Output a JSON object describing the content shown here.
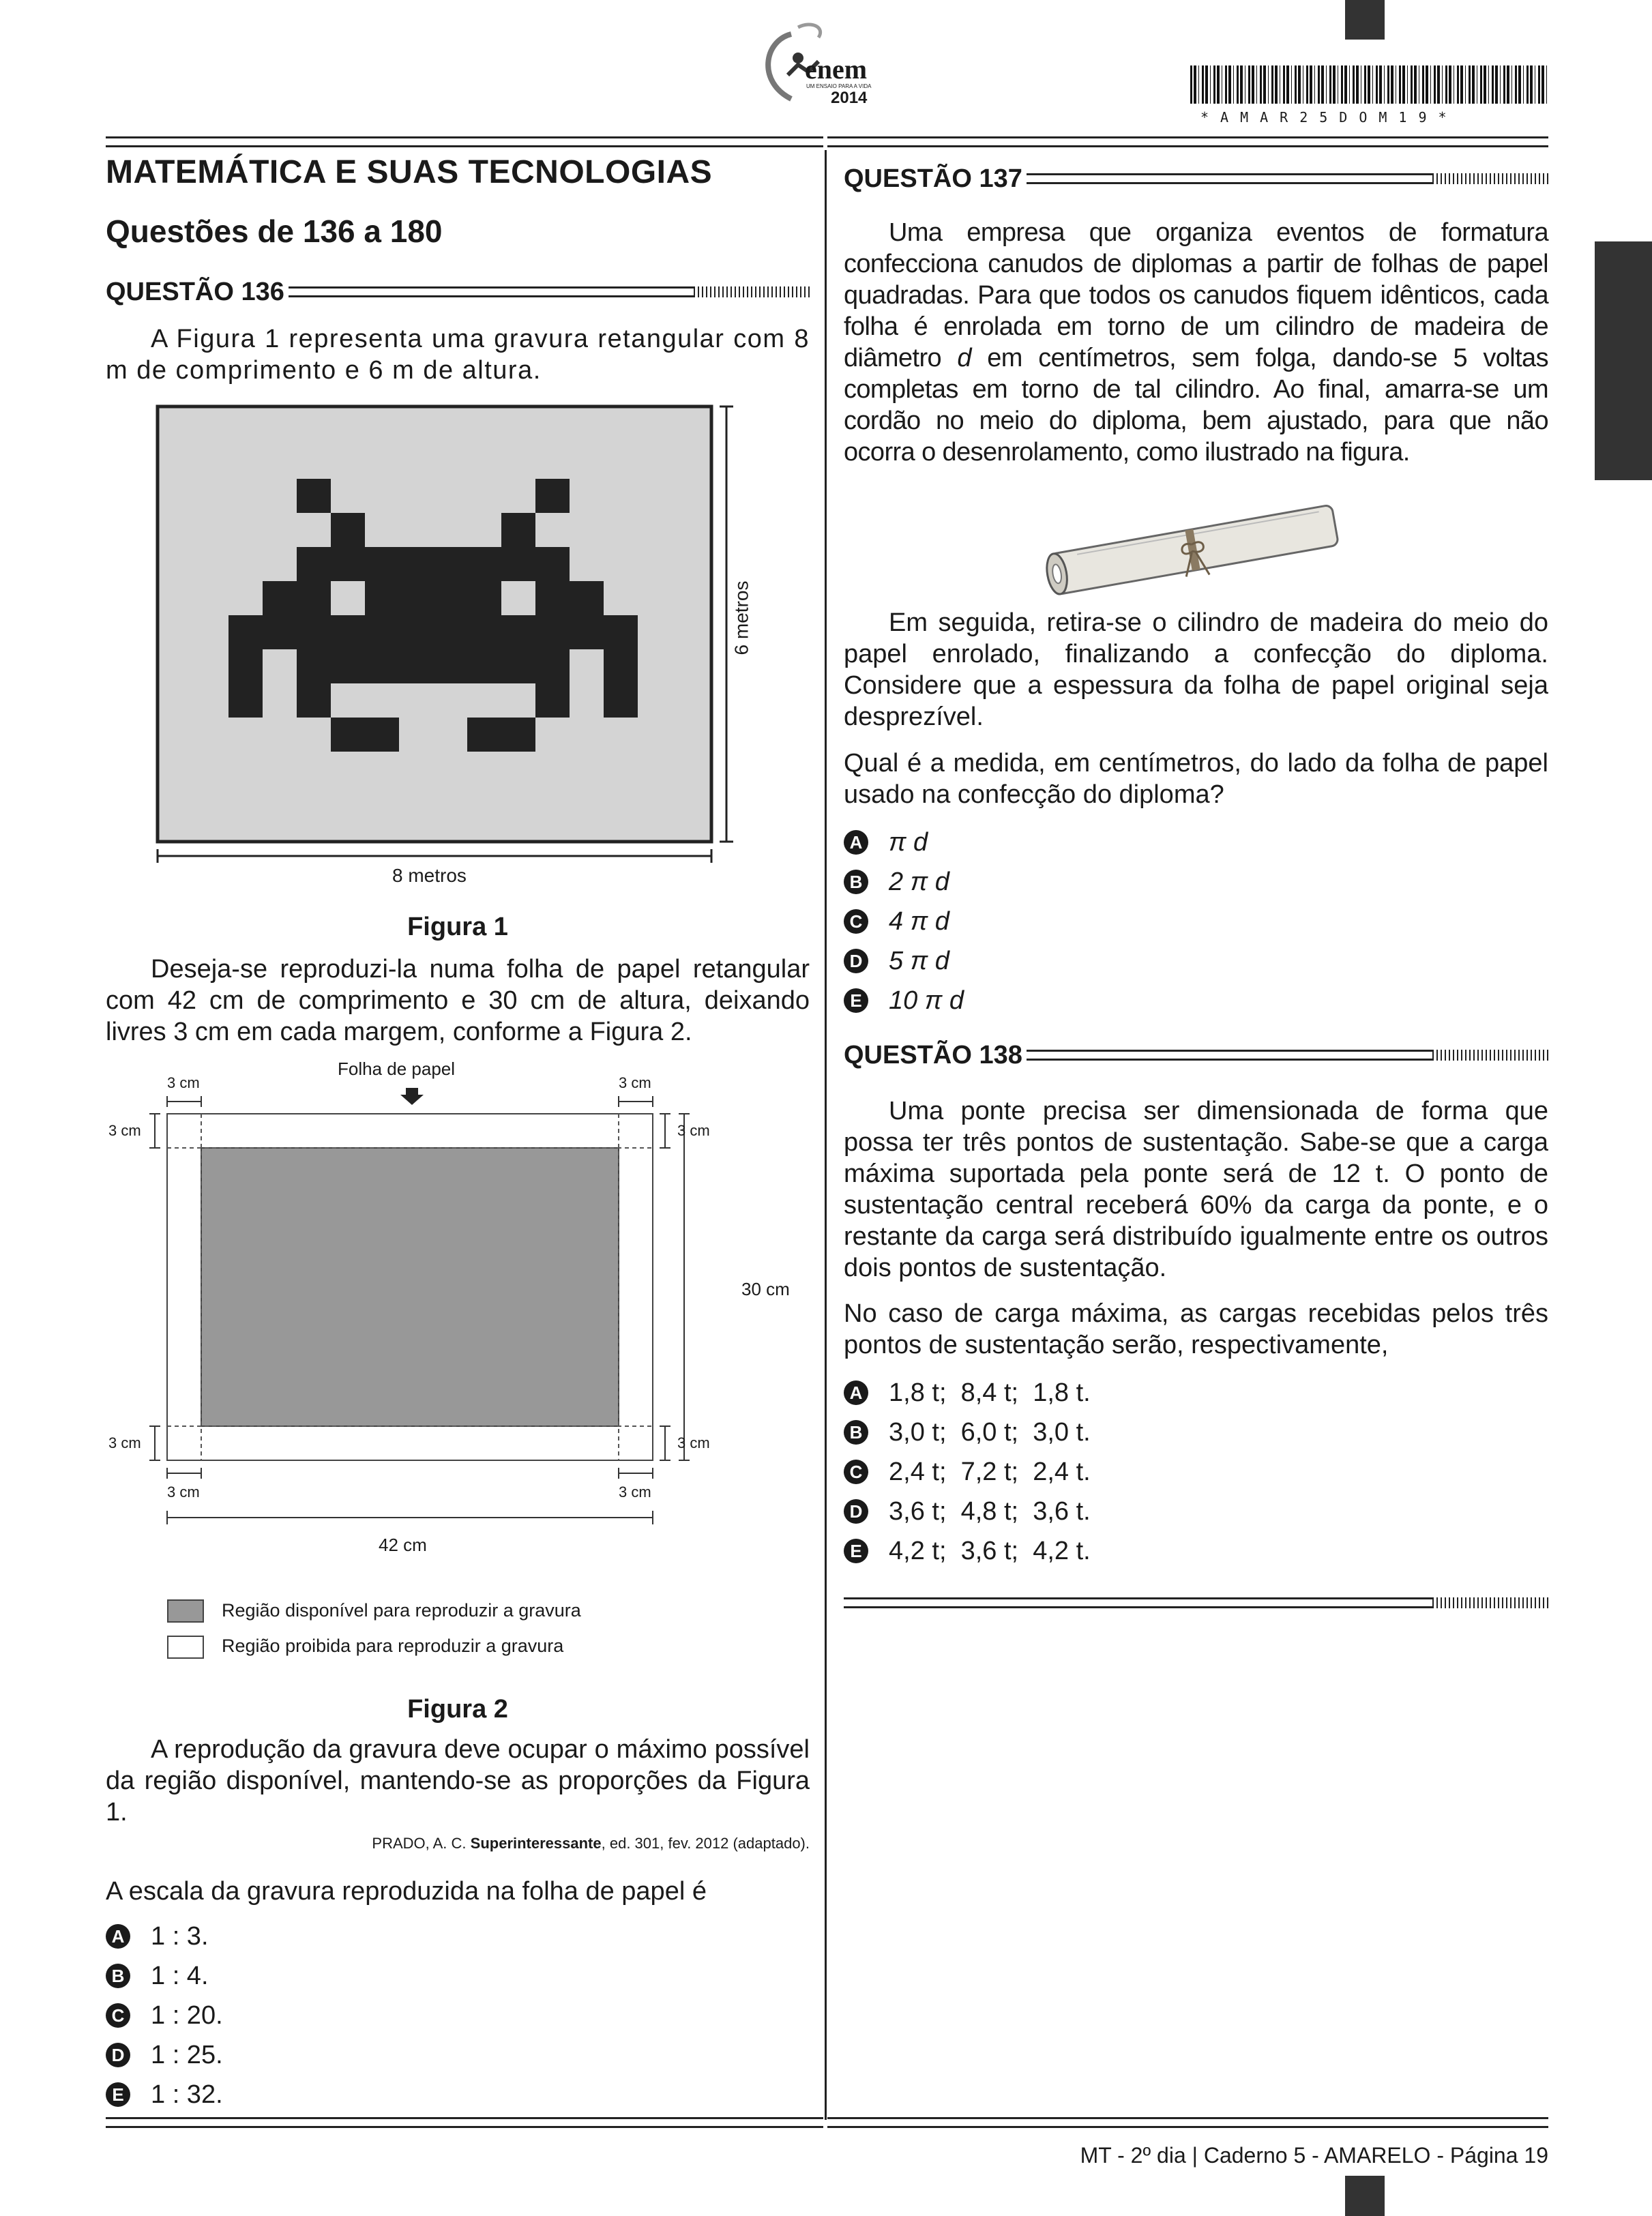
{
  "header": {
    "logo_text": "enem",
    "logo_tagline": "UM ENSAIO PARA A VIDA",
    "logo_year": "2014",
    "barcode_text": "*AMAR25DOM19*"
  },
  "left": {
    "section_title": "MATEMÁTICA E SUAS TECNOLOGIAS",
    "section_subtitle": "Questões de 136 a 180",
    "q136": {
      "label": "QUESTÃO 136",
      "intro": "A Figura 1 representa uma gravura retangular com 8 m de comprimento e 6 m de altura.",
      "fig1": {
        "width_label": "8 metros",
        "height_label": "6 metros",
        "caption": "Figura 1"
      },
      "text2": "Deseja-se reproduzi-la numa folha de papel retangular com 42 cm de comprimento e 30 cm de altura, deixando livres 3 cm em cada margem, conforme a Figura 2.",
      "fig2": {
        "paper_label": "Folha de papel",
        "margin_label": "3 cm",
        "height_label": "30 cm",
        "width_label": "42 cm",
        "legend_available": "Região disponível para reproduzir a gravura",
        "legend_forbidden": "Região proibida para reproduzir a gravura",
        "caption": "Figura 2"
      },
      "text3": "A reprodução da gravura deve ocupar o máximo possível da região disponível, mantendo-se as proporções da Figura 1.",
      "source_prefix": "PRADO, A. C. ",
      "source_bold": "Superinteressante",
      "source_suffix": ", ed. 301, fev. 2012 (adaptado).",
      "question": "A escala da gravura reproduzida na folha de papel é",
      "options": [
        {
          "letter": "A",
          "text": "1 : 3."
        },
        {
          "letter": "B",
          "text": "1 : 4."
        },
        {
          "letter": "C",
          "text": "1 : 20."
        },
        {
          "letter": "D",
          "text": "1 : 25."
        },
        {
          "letter": "E",
          "text": "1 : 32."
        }
      ]
    }
  },
  "right": {
    "q137": {
      "label": "QUESTÃO 137",
      "para1": "Uma empresa que organiza eventos de formatura confecciona canudos de diplomas a partir de folhas de papel quadradas. Para que todos os canudos fiquem idênticos, cada folha é enrolada em torno de um cilindro de madeira de diâmetro d em centímetros, sem folga, dando-se 5 voltas completas em torno de tal cilindro. Ao final, amarra-se um cordão no meio do diploma, bem ajustado, para que não ocorra o desenrolamento, como ilustrado na figura.",
      "para2": "Em seguida, retira-se o cilindro de madeira do meio do papel enrolado, finalizando a confecção do diploma. Considere que a espessura da folha de papel original seja desprezível.",
      "question": "Qual é a medida, em centímetros, do lado da folha de papel usado na confecção do diploma?",
      "options": [
        {
          "letter": "A",
          "text": "π d"
        },
        {
          "letter": "B",
          "text": "2 π d"
        },
        {
          "letter": "C",
          "text": "4 π d"
        },
        {
          "letter": "D",
          "text": "5 π d"
        },
        {
          "letter": "E",
          "text": "10 π d"
        }
      ]
    },
    "q138": {
      "label": "QUESTÃO 138",
      "para1": "Uma ponte precisa ser dimensionada de forma que possa ter três pontos de sustentação. Sabe-se que a carga máxima suportada pela ponte será de 12 t. O ponto de sustentação central receberá 60% da carga da ponte, e o restante da carga será distribuído igualmente entre os outros dois pontos de sustentação.",
      "question": "No caso de carga máxima, as cargas recebidas pelos três pontos de sustentação serão, respectivamente,",
      "options": [
        {
          "letter": "A",
          "text": "1,8 t;  8,4 t;  1,8 t."
        },
        {
          "letter": "B",
          "text": "3,0 t;  6,0 t;  3,0 t."
        },
        {
          "letter": "C",
          "text": "2,4 t;  7,2 t;  2,4 t."
        },
        {
          "letter": "D",
          "text": "3,6 t;  4,8 t;  3,6 t."
        },
        {
          "letter": "E",
          "text": "4,2 t;  3,6 t;  4,2 t."
        }
      ]
    }
  },
  "footer": {
    "text": "MT - 2º dia | Caderno 5 - AMARELO - Página 19"
  }
}
